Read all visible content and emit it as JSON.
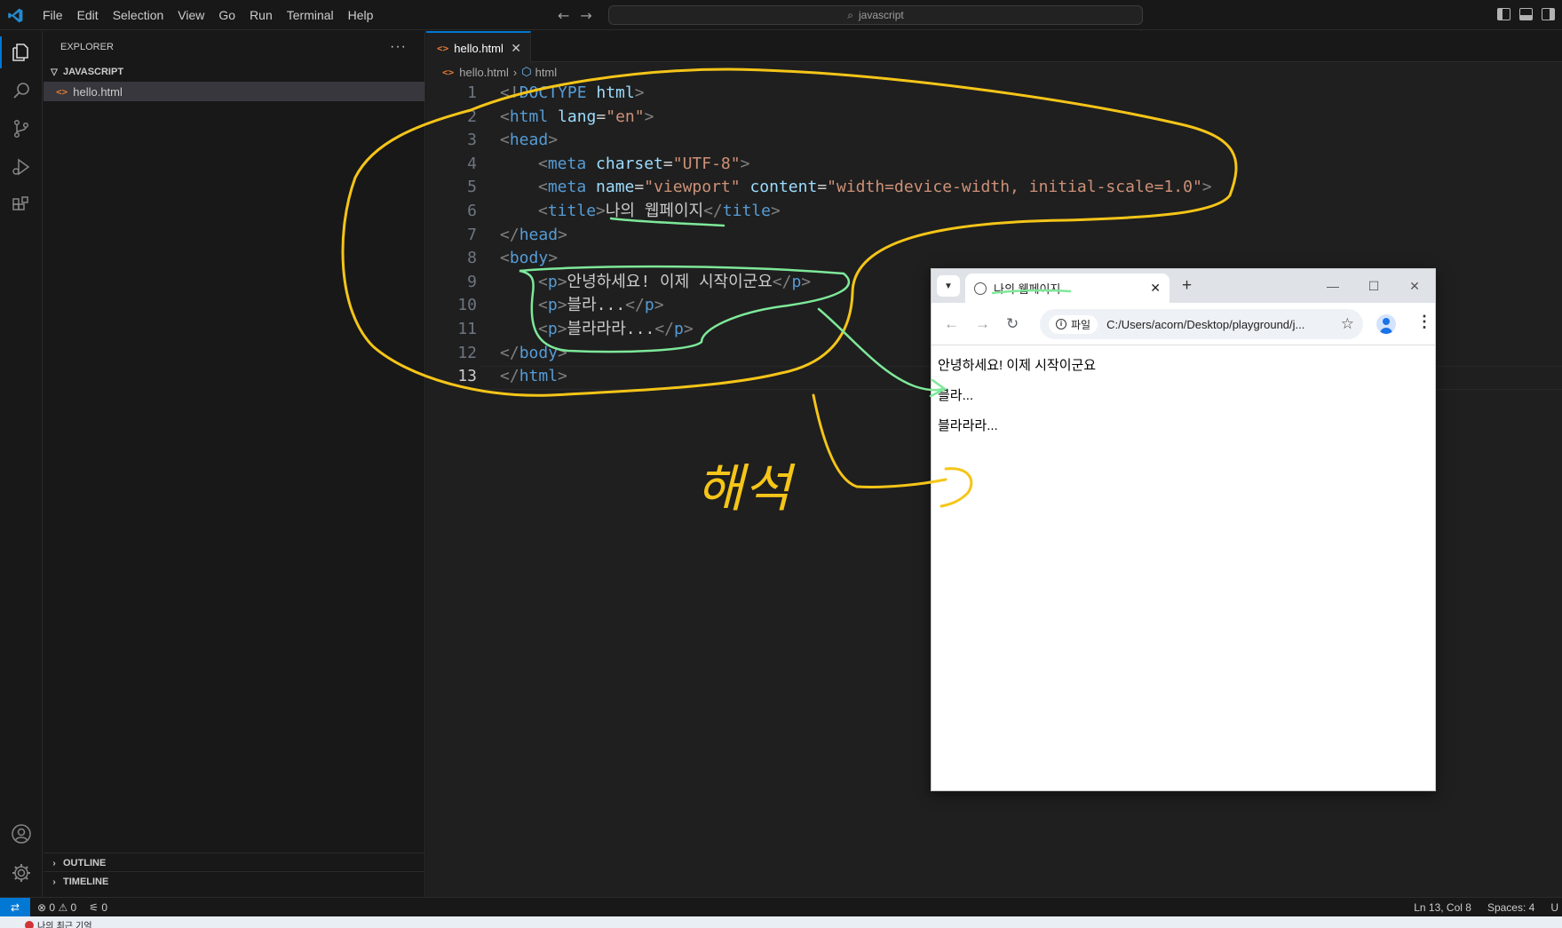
{
  "titlebar": {
    "menu": [
      "File",
      "Edit",
      "Selection",
      "View",
      "Go",
      "Run",
      "Terminal",
      "Help"
    ],
    "search_text": "javascript"
  },
  "sidebar": {
    "title": "EXPLORER",
    "more": "···",
    "folder": "JAVASCRIPT",
    "file": "hello.html",
    "outline": "OUTLINE",
    "timeline": "TIMELINE"
  },
  "editor": {
    "tab_label": "hello.html",
    "breadcrumb_file": "hello.html",
    "breadcrumb_symbol": "html",
    "line_numbers": [
      "1",
      "2",
      "3",
      "4",
      "5",
      "6",
      "7",
      "8",
      "9",
      "10",
      "11",
      "12",
      "13"
    ],
    "lines": {
      "l1": {
        "a": "<!",
        "b": "DOCTYPE",
        "c": " html",
        "d": ">"
      },
      "l2": {
        "a": "<",
        "tag": "html",
        "attr": " lang",
        "eq": "=",
        "val": "\"en\"",
        "close": ">"
      },
      "l3": {
        "a": "<",
        "tag": "head",
        "close": ">"
      },
      "l4": {
        "a": "<",
        "tag": "meta",
        "attr": " charset",
        "eq": "=",
        "val": "\"UTF-8\"",
        "close": ">"
      },
      "l5": {
        "a": "<",
        "tag": "meta",
        "attr1": " name",
        "eq1": "=",
        "val1": "\"viewport\"",
        "attr2": " content",
        "eq2": "=",
        "val2": "\"width=device-width, initial-scale=1.0\"",
        "close": ">"
      },
      "l6": {
        "a": "<",
        "tag": "title",
        "close": ">",
        "text": "나의 웹페이지",
        "end_open": "</",
        "end_tag": "title",
        "end_close": ">"
      },
      "l7": {
        "a": "</",
        "tag": "head",
        "close": ">"
      },
      "l8": {
        "a": "<",
        "tag": "body",
        "close": ">"
      },
      "l9": {
        "a": "<",
        "tag": "p",
        "close": ">",
        "text": "안녕하세요! 이제 시작이군요",
        "end_open": "</",
        "end_tag": "p",
        "end_close": ">"
      },
      "l10": {
        "a": "<",
        "tag": "p",
        "close": ">",
        "text": "블라...",
        "end_open": "</",
        "end_tag": "p",
        "end_close": ">"
      },
      "l11": {
        "a": "<",
        "tag": "p",
        "close": ">",
        "text": "블라라라...",
        "end_open": "</",
        "end_tag": "p",
        "end_close": ">"
      },
      "l12": {
        "a": "</",
        "tag": "body",
        "close": ">"
      },
      "l13": {
        "a": "</",
        "tag": "html",
        "close": ">"
      }
    }
  },
  "browser": {
    "tab_title": "나의 웹페이지",
    "chip": "파일",
    "url": "C:/Users/acorn/Desktop/playground/j...",
    "paragraphs": [
      "안녕하세요! 이제 시작이군요",
      "블라...",
      "블라라라..."
    ]
  },
  "annotation": {
    "handwriting": "해석",
    "colors": {
      "yellow": "#f5c518",
      "green": "#7ee89a"
    }
  },
  "statusbar": {
    "errors": "0",
    "warnings": "0",
    "ports": "0",
    "position": "Ln 13, Col 8",
    "spaces": "Spaces: 4",
    "encoding": "U"
  },
  "taskbar": {
    "item": "나의 최근 기억"
  }
}
